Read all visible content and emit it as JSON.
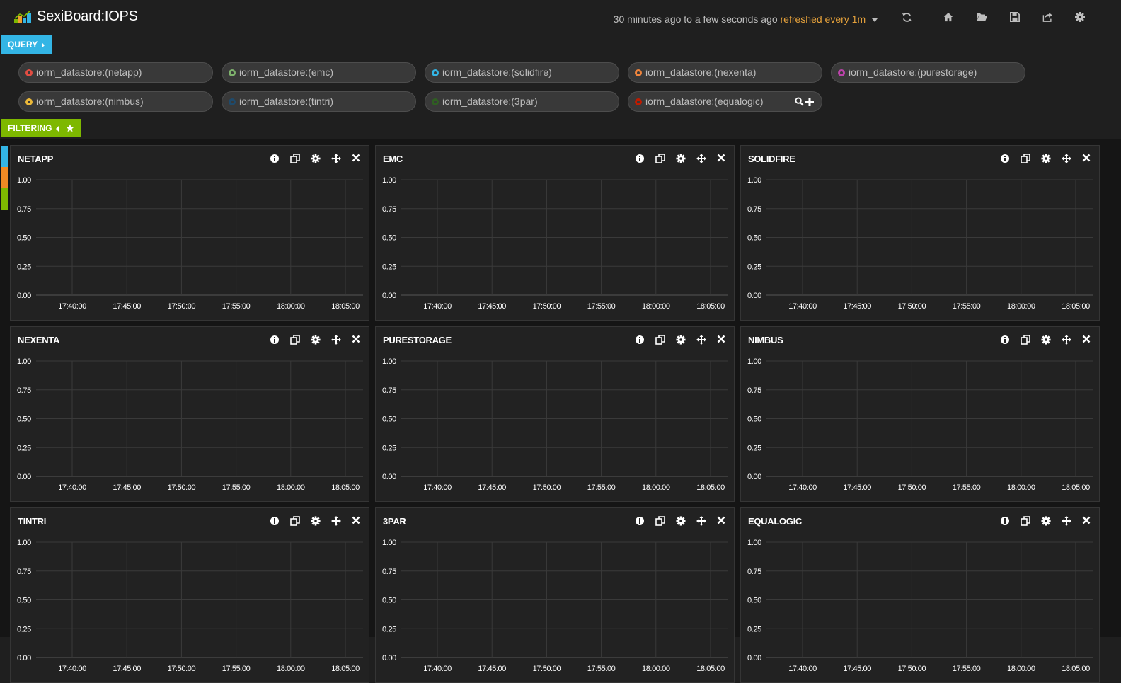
{
  "app": {
    "title": "SexiBoard:IOPS"
  },
  "timepicker": {
    "range": "30 minutes ago to a few seconds ago",
    "refresh": "refreshed every 1m"
  },
  "nav_icons": [
    "refresh-icon",
    "home-icon",
    "folder-open-icon",
    "save-icon",
    "share-icon",
    "gear-icon"
  ],
  "query": {
    "tab_label": "QUERY",
    "items": [
      {
        "label": "iorm_datastore:(netapp)",
        "color": "#e24d42"
      },
      {
        "label": "iorm_datastore:(emc)",
        "color": "#7eb26d"
      },
      {
        "label": "iorm_datastore:(solidfire)",
        "color": "#33b5e5"
      },
      {
        "label": "iorm_datastore:(nexenta)",
        "color": "#ef843c"
      },
      {
        "label": "iorm_datastore:(purestorage)",
        "color": "#ba43a9"
      },
      {
        "label": "iorm_datastore:(nimbus)",
        "color": "#eab839"
      },
      {
        "label": "iorm_datastore:(tintri)",
        "color": "#1f4a6b"
      },
      {
        "label": "iorm_datastore:(3par)",
        "color": "#2f5e22"
      },
      {
        "label": "iorm_datastore:(equalogic)",
        "color": "#bf1b00"
      }
    ]
  },
  "filtering": {
    "tab_label": "FILTERING"
  },
  "side_colors": [
    "#33b5e5",
    "#f08a24",
    "#7eb800"
  ],
  "panels": [
    {
      "title": "NETAPP"
    },
    {
      "title": "EMC"
    },
    {
      "title": "SOLIDFIRE"
    },
    {
      "title": "NEXENTA"
    },
    {
      "title": "PURESTORAGE"
    },
    {
      "title": "NIMBUS"
    },
    {
      "title": "TINTRI"
    },
    {
      "title": "3PAR"
    },
    {
      "title": "EQUALOGIC"
    }
  ],
  "chart_data": {
    "type": "line",
    "y_ticks": [
      "1.00",
      "0.75",
      "0.50",
      "0.25",
      "0.00"
    ],
    "x_ticks": [
      "17:40:00",
      "17:45:00",
      "17:50:00",
      "17:55:00",
      "18:00:00",
      "18:05:00"
    ],
    "ylim": [
      0,
      1
    ],
    "grid": true,
    "series": []
  }
}
